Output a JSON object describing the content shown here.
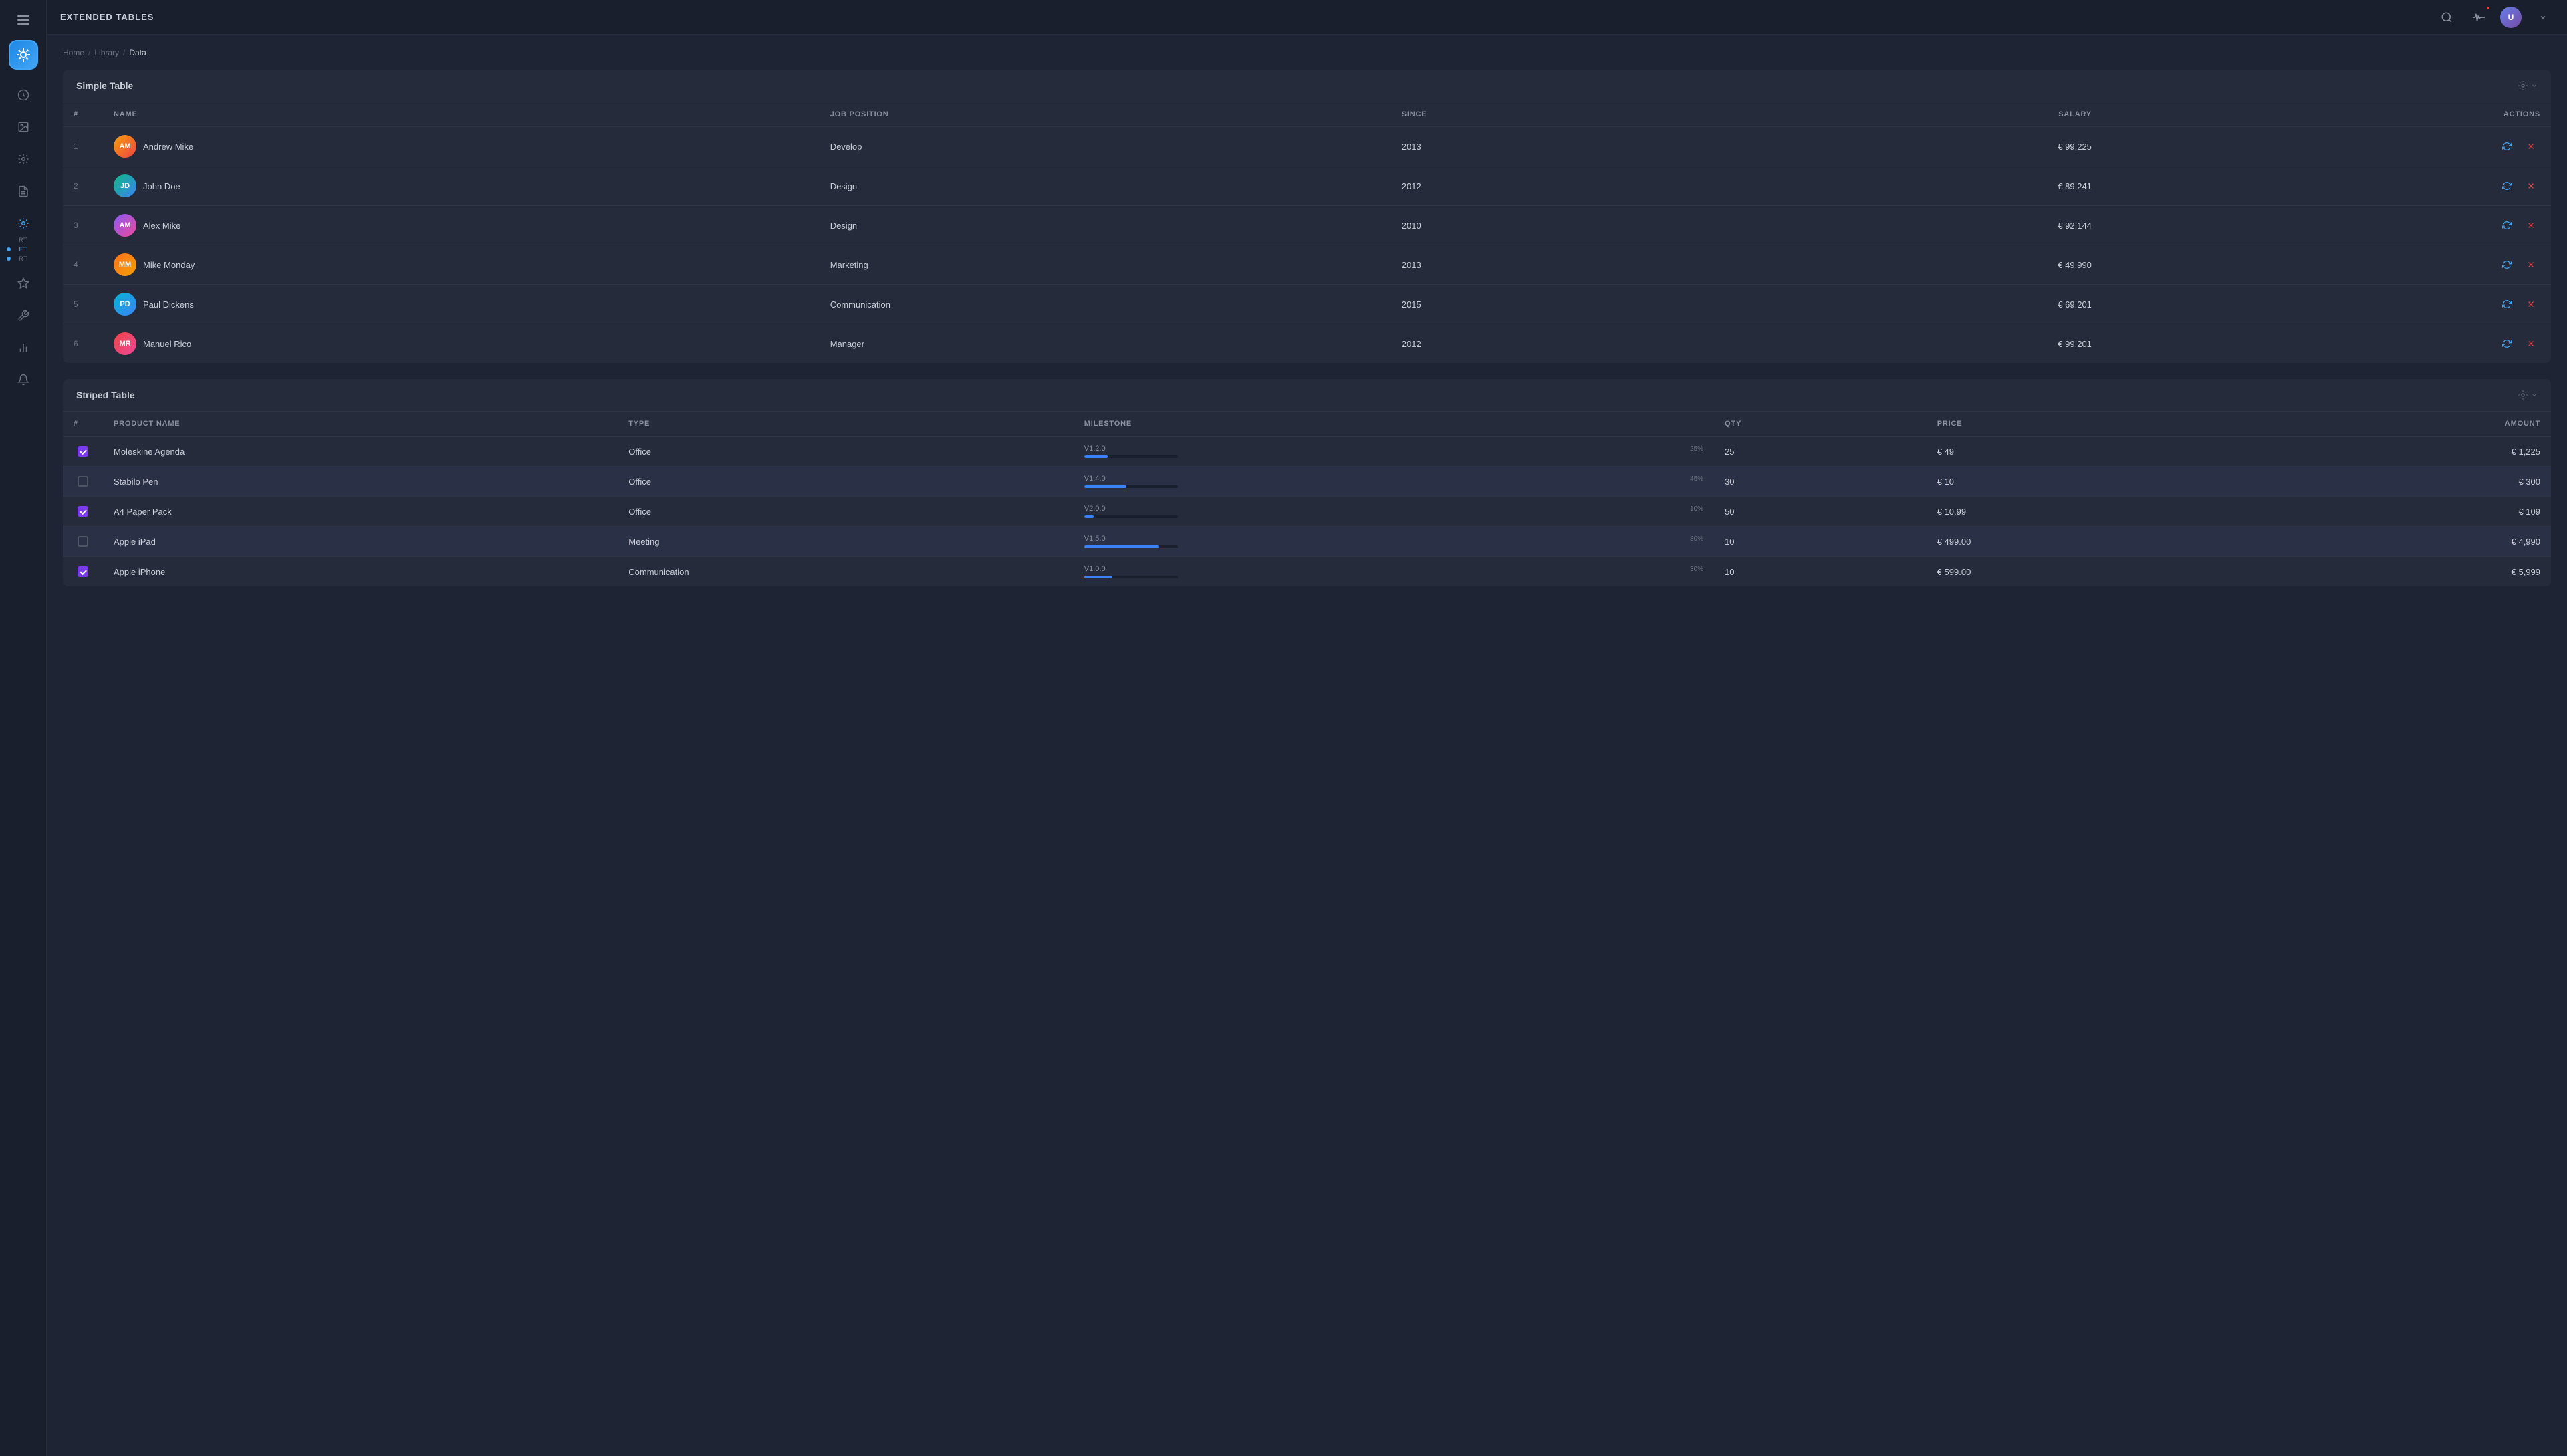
{
  "app": {
    "title": "EXTENDED TABLES"
  },
  "header": {
    "title": "EXTENDED TABLES",
    "avatar_initials": "U"
  },
  "breadcrumb": {
    "home": "Home",
    "library": "Library",
    "current": "Data"
  },
  "sidebar": {
    "nav_items": [
      {
        "id": "analytics",
        "label": ""
      },
      {
        "id": "image",
        "label": ""
      },
      {
        "id": "settings",
        "label": ""
      },
      {
        "id": "document",
        "label": ""
      },
      {
        "id": "star",
        "label": ""
      },
      {
        "id": "tools",
        "label": ""
      },
      {
        "id": "chart",
        "label": ""
      },
      {
        "id": "bell",
        "label": ""
      }
    ],
    "nav_labels": [
      {
        "id": "rt1",
        "label": "RT"
      },
      {
        "id": "et",
        "label": "ET",
        "active": true
      },
      {
        "id": "rt2",
        "label": "RT"
      }
    ]
  },
  "simple_table": {
    "title": "Simple Table",
    "columns": [
      "#",
      "NAME",
      "JOB POSITION",
      "SINCE",
      "SALARY",
      "ACTIONS"
    ],
    "rows": [
      {
        "id": 1,
        "name": "Andrew Mike",
        "position": "Develop",
        "since": 2013,
        "salary": "€ 99,225",
        "av": "av-1",
        "initials": "AM"
      },
      {
        "id": 2,
        "name": "John Doe",
        "position": "Design",
        "since": 2012,
        "salary": "€ 89,241",
        "av": "av-2",
        "initials": "JD"
      },
      {
        "id": 3,
        "name": "Alex Mike",
        "position": "Design",
        "since": 2010,
        "salary": "€ 92,144",
        "av": "av-3",
        "initials": "AM"
      },
      {
        "id": 4,
        "name": "Mike Monday",
        "position": "Marketing",
        "since": 2013,
        "salary": "€ 49,990",
        "av": "av-4",
        "initials": "MM"
      },
      {
        "id": 5,
        "name": "Paul Dickens",
        "position": "Communication",
        "since": 2015,
        "salary": "€ 69,201",
        "av": "av-5",
        "initials": "PD"
      },
      {
        "id": 6,
        "name": "Manuel Rico",
        "position": "Manager",
        "since": 2012,
        "salary": "€ 99,201",
        "av": "av-6",
        "initials": "MR"
      }
    ]
  },
  "striped_table": {
    "title": "Striped Table",
    "columns": [
      "#",
      "PRODUCT NAME",
      "TYPE",
      "MILESTONE",
      "QTY",
      "PRICE",
      "AMOUNT"
    ],
    "rows": [
      {
        "id": 1,
        "checked": true,
        "name": "Moleskine Agenda",
        "type": "Office",
        "milestone_version": "V1.2.0",
        "milestone_pct": 25,
        "qty": 25,
        "price": "€ 49",
        "amount": "€ 1,225"
      },
      {
        "id": 2,
        "checked": false,
        "name": "Stabilo Pen",
        "type": "Office",
        "milestone_version": "V1.4.0",
        "milestone_pct": 45,
        "qty": 30,
        "price": "€ 10",
        "amount": "€ 300"
      },
      {
        "id": 3,
        "checked": true,
        "name": "A4 Paper Pack",
        "type": "Office",
        "milestone_version": "V2.0.0",
        "milestone_pct": 10,
        "qty": 50,
        "price": "€ 10.99",
        "amount": "€ 109"
      },
      {
        "id": 4,
        "checked": false,
        "name": "Apple iPad",
        "type": "Meeting",
        "milestone_version": "V1.5.0",
        "milestone_pct": 80,
        "qty": 10,
        "price": "€ 499.00",
        "amount": "€ 4,990"
      },
      {
        "id": 5,
        "checked": true,
        "name": "Apple iPhone",
        "type": "Communication",
        "milestone_version": "V1.0.0",
        "milestone_pct": 30,
        "qty": 10,
        "price": "€ 599.00",
        "amount": "€ 5,999"
      }
    ]
  }
}
